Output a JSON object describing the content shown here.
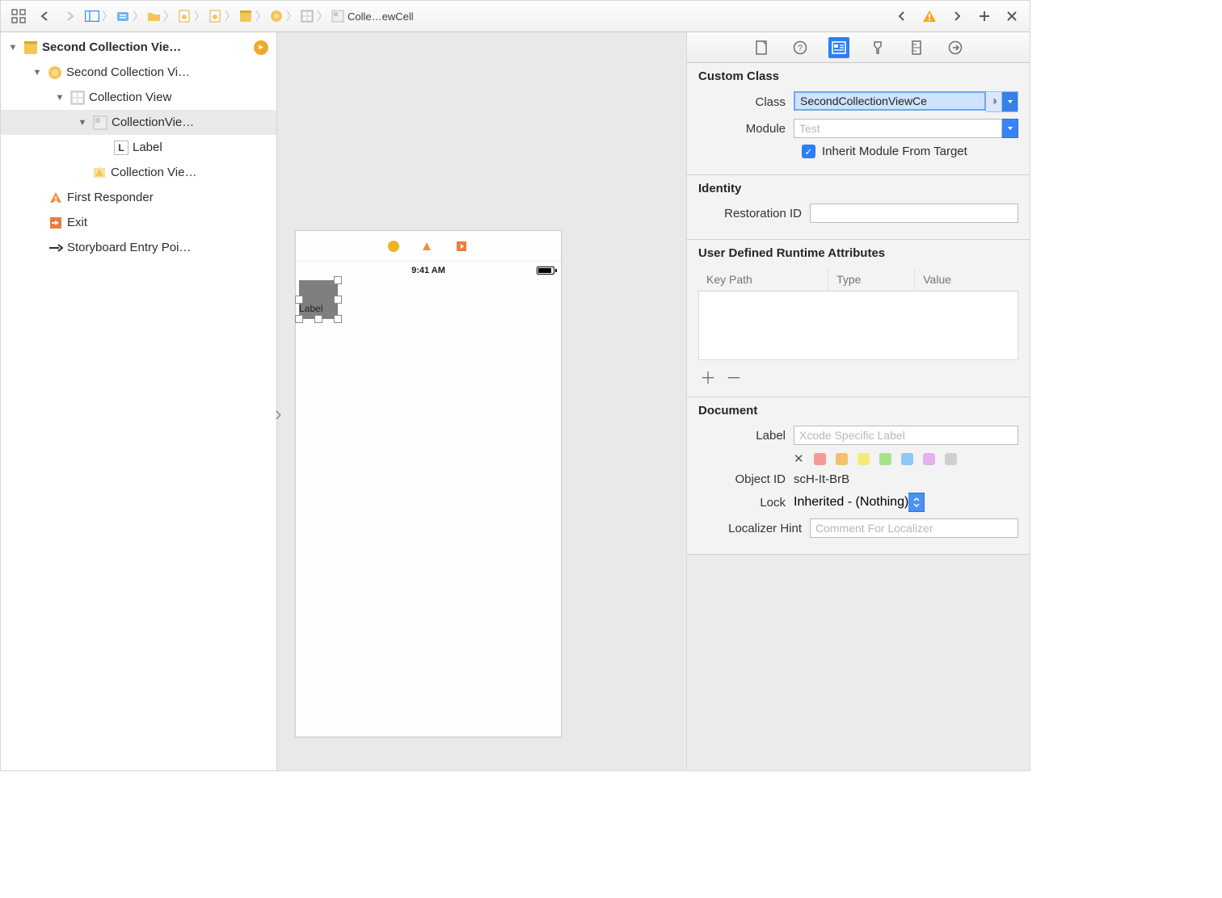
{
  "toolbar": {
    "breadcrumb_label": "Colle…ewCell"
  },
  "outline": {
    "scene": "Second Collection Vie…",
    "controller": "Second Collection Vi…",
    "collectionView": "Collection View",
    "cell": "CollectionVie…",
    "label": "Label",
    "flowLayout": "Collection Vie…",
    "firstResponder": "First Responder",
    "exit": "Exit",
    "entryPoint": "Storyboard Entry Poi…"
  },
  "canvas": {
    "time": "9:41 AM",
    "cellLabel": "Label"
  },
  "inspector": {
    "customClass": {
      "title": "Custom Class",
      "classLabel": "Class",
      "classValue": "SecondCollectionViewCe",
      "moduleLabel": "Module",
      "modulePlaceholder": "Test",
      "inheritLabel": "Inherit Module From Target"
    },
    "identity": {
      "title": "Identity",
      "restorationLabel": "Restoration ID"
    },
    "runtime": {
      "title": "User Defined Runtime Attributes",
      "col1": "Key Path",
      "col2": "Type",
      "col3": "Value"
    },
    "document": {
      "title": "Document",
      "labelLabel": "Label",
      "labelPlaceholder": "Xcode Specific Label",
      "objectIdLabel": "Object ID",
      "objectIdValue": "scH-It-BrB",
      "lockLabel": "Lock",
      "lockValue": "Inherited - (Nothing)",
      "hintLabel": "Localizer Hint",
      "hintPlaceholder": "Comment For Localizer",
      "colors": [
        "#f09b94",
        "#f3c06b",
        "#f4ea78",
        "#a8e18c",
        "#8fc6f4",
        "#e3b1ef",
        "#cfcfcf"
      ]
    }
  }
}
